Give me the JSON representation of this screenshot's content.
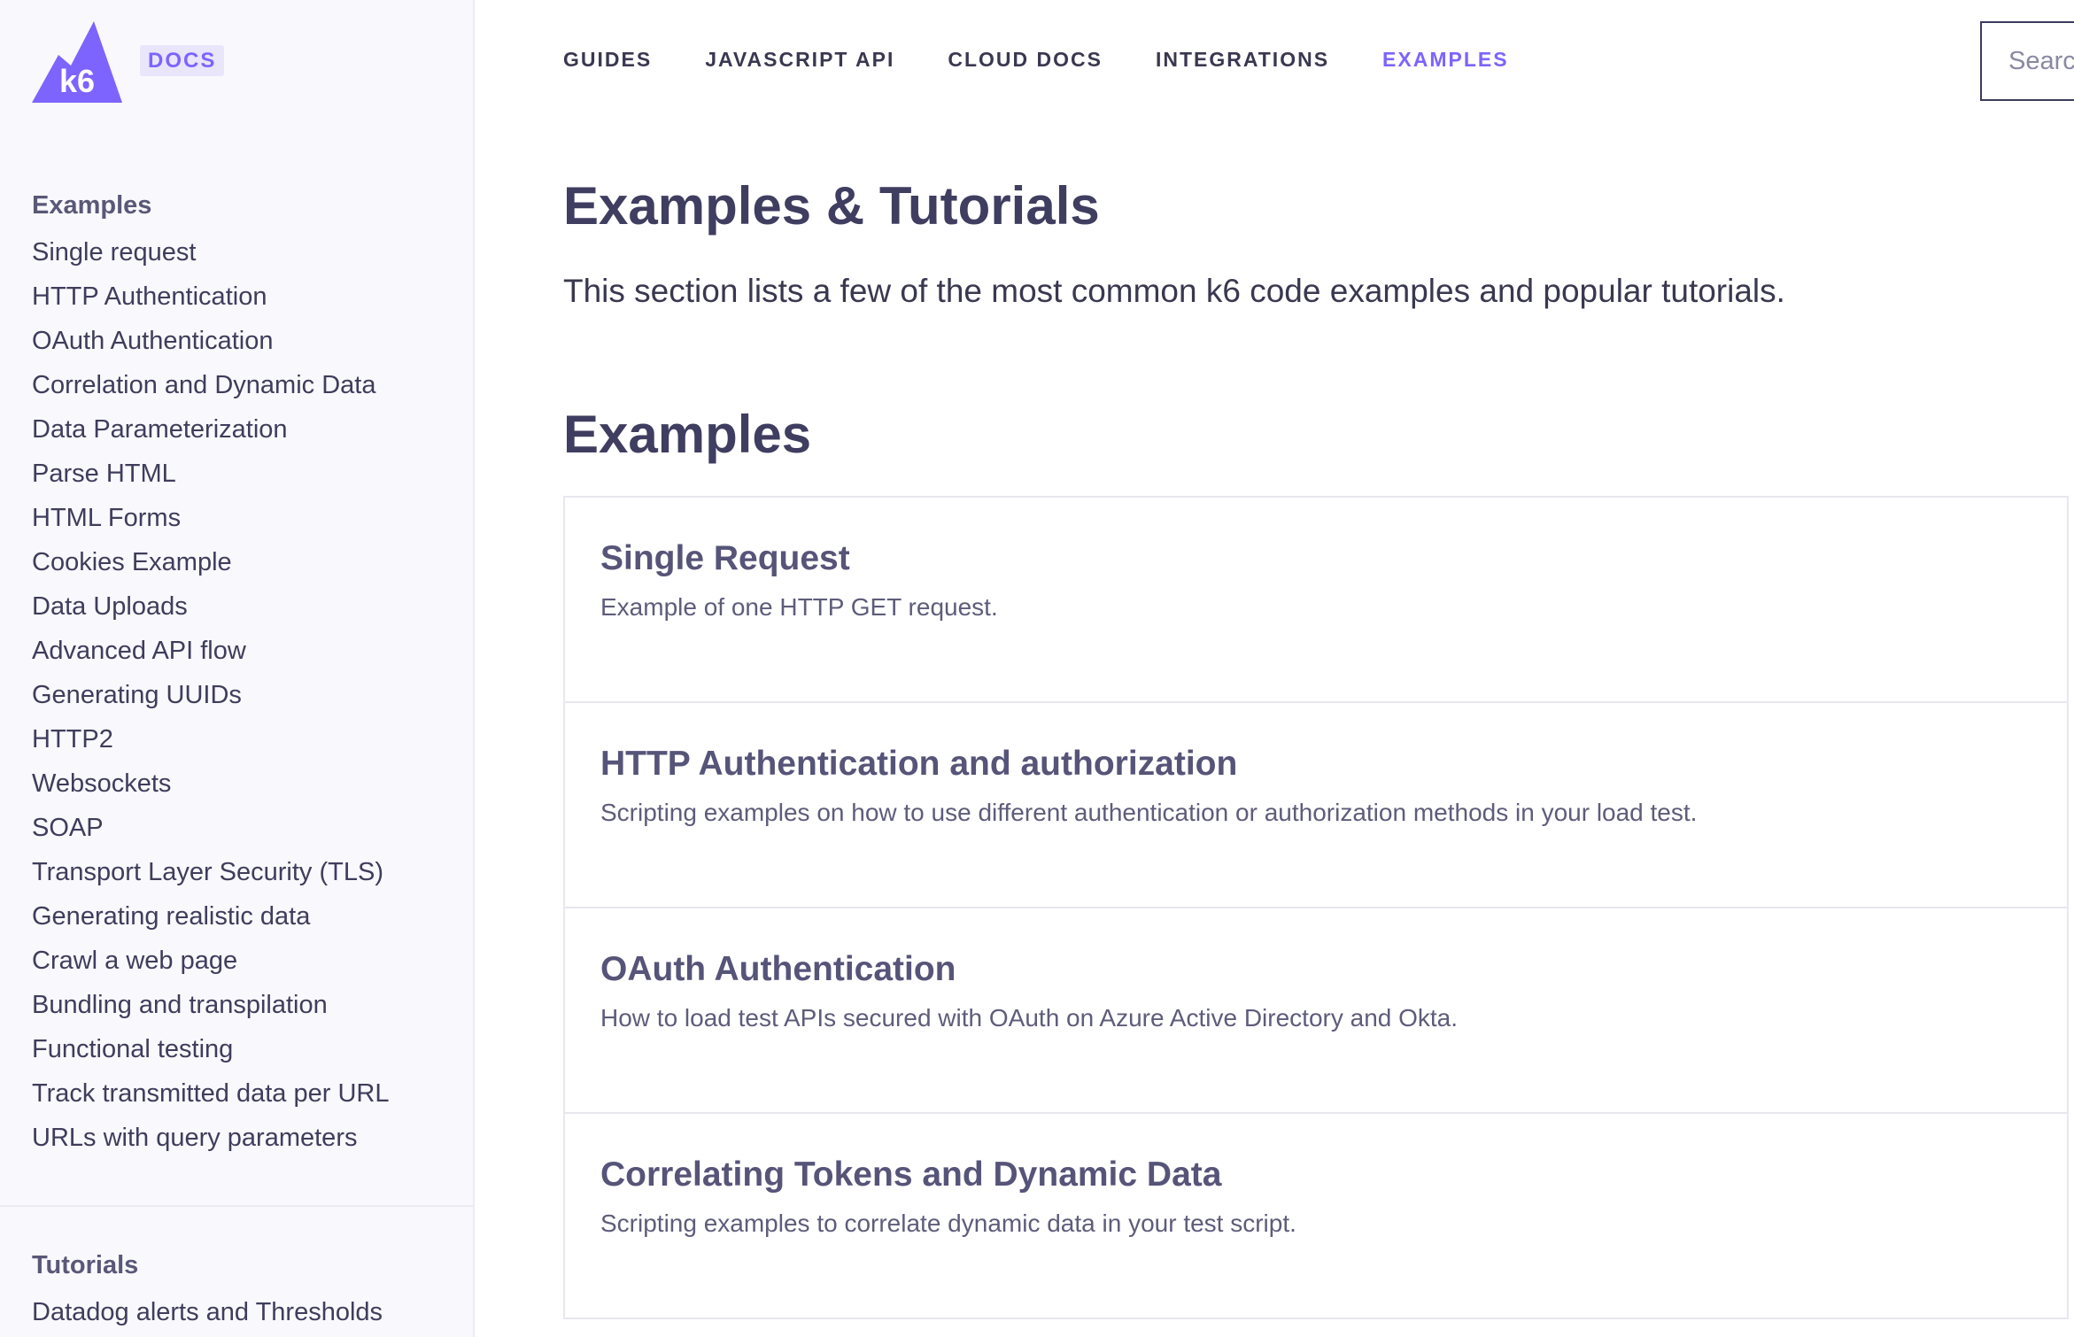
{
  "brand": {
    "logo_text": "k6",
    "badge": "DOCS",
    "accent": "#7d64ff"
  },
  "topnav": {
    "items": [
      {
        "label": "GUIDES",
        "active": false
      },
      {
        "label": "JAVASCRIPT API",
        "active": false
      },
      {
        "label": "CLOUD DOCS",
        "active": false
      },
      {
        "label": "INTEGRATIONS",
        "active": false
      },
      {
        "label": "EXAMPLES",
        "active": true
      }
    ],
    "search_placeholder": "Search"
  },
  "sidebar": {
    "examples_heading": "Examples",
    "examples": [
      "Single request",
      "HTTP Authentication",
      "OAuth Authentication",
      "Correlation and Dynamic Data",
      "Data Parameterization",
      "Parse HTML",
      "HTML Forms",
      "Cookies Example",
      "Data Uploads",
      "Advanced API flow",
      "Generating UUIDs",
      "HTTP2",
      "Websockets",
      "SOAP",
      "Transport Layer Security (TLS)",
      "Generating realistic data",
      "Crawl a web page",
      "Bundling and transpilation",
      "Functional testing",
      "Track transmitted data per URL",
      "URLs with query parameters"
    ],
    "tutorials_heading": "Tutorials",
    "tutorials": [
      "Datadog alerts and Thresholds"
    ]
  },
  "main": {
    "title": "Examples & Tutorials",
    "description": "This section lists a few of the most common k6 code examples and popular tutorials.",
    "section_title": "Examples",
    "cards": [
      {
        "title": "Single Request",
        "desc": "Example of one HTTP GET request."
      },
      {
        "title": "HTTP Authentication and authorization",
        "desc": "Scripting examples on how to use different authentication or authorization methods in your load test."
      },
      {
        "title": "OAuth Authentication",
        "desc": "How to load test APIs secured with OAuth on Azure Active Directory and Okta."
      },
      {
        "title": "Correlating Tokens and Dynamic Data",
        "desc": "Scripting examples to correlate dynamic data in your test script."
      }
    ]
  }
}
